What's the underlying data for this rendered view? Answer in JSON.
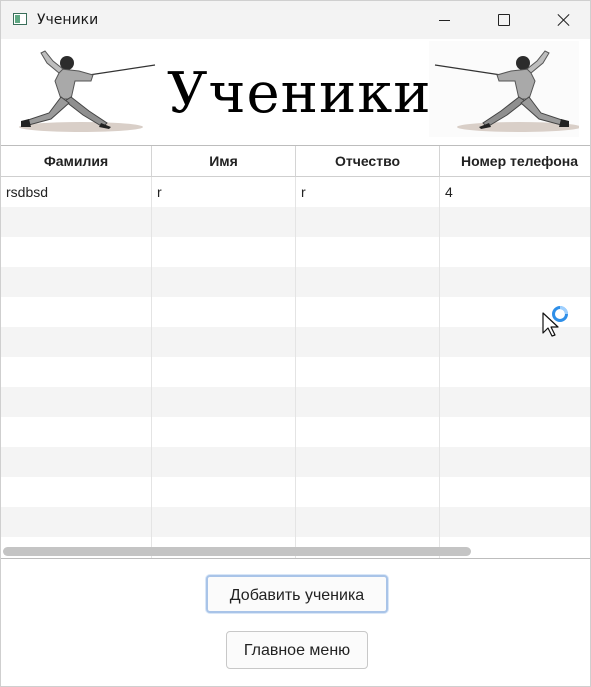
{
  "window": {
    "title": "Ученики",
    "icons": [
      "app-icon",
      "minimize-icon",
      "maximize-icon",
      "close-icon"
    ]
  },
  "banner": {
    "title": "Ученики",
    "images": [
      "fencer-left-image",
      "fencer-right-image"
    ]
  },
  "table": {
    "columns": [
      "Фамилия",
      "Имя",
      "Отчество",
      "Номер телефона"
    ],
    "rows": [
      [
        "rsdbsd",
        "r",
        "r",
        "4"
      ]
    ]
  },
  "buttons": {
    "add_student": "Добавить ученика",
    "main_menu": "Главное меню"
  },
  "colors": {
    "titlebar": "#f3f3f3",
    "row_stripe": "#f4f4f4",
    "focus_border": "#a9c4e8",
    "busy_indicator": "#2f8fe8"
  }
}
